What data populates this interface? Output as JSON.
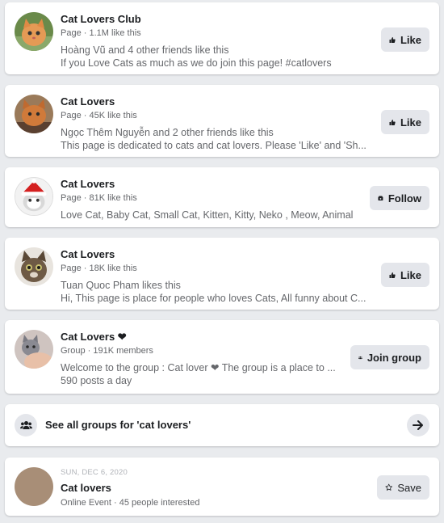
{
  "results": [
    {
      "title": "Cat Lovers Club",
      "meta": "Page · 1.1M like this",
      "line1": "Hoàng Vũ and 4 other friends like this",
      "line2": "If you Love Cats as much as we do join this page! #catlovers",
      "button": "Like",
      "button_icon": "thumbs-up-icon"
    },
    {
      "title": "Cat Lovers",
      "meta": "Page · 45K like this",
      "line1": "Ngọc Thêm Nguyễn and 2 other friends like this",
      "line2": "This page is dedicated to cats and cat lovers. Please 'Like' and 'Sh...",
      "button": "Like",
      "button_icon": "thumbs-up-icon"
    },
    {
      "title": "Cat Lovers",
      "meta": "Page · 81K like this",
      "line1": "Love Cat, Baby Cat, Small Cat, Kitten, Kitty, Neko , Meow, Animal",
      "button": "Follow",
      "button_icon": "follow-icon"
    },
    {
      "title": "Cat Lovers",
      "meta": "Page · 18K like this",
      "line1": "Tuan Quoc Pham likes this",
      "line2": "Hi, This page is place for people who loves Cats, All funny about C...",
      "button": "Like",
      "button_icon": "thumbs-up-icon"
    },
    {
      "title": "Cat Lovers ❤",
      "meta": "Group · 191K members",
      "line1": "Welcome to the group : Cat lover ❤ The group is a place to ...",
      "line2": "590 posts a day",
      "button": "Join group",
      "button_icon": "group-icon"
    }
  ],
  "see_all": {
    "label": "See all groups for 'cat lovers'"
  },
  "event": {
    "date": "SUN, DEC 6, 2020",
    "title": "Cat lovers",
    "meta": "Online Event · 45 people interested",
    "button": "Save"
  },
  "colors": {
    "card": "#ffffff",
    "background": "#e9ebee",
    "button": "#e4e6eb",
    "event_avatar": "#a88e77"
  }
}
